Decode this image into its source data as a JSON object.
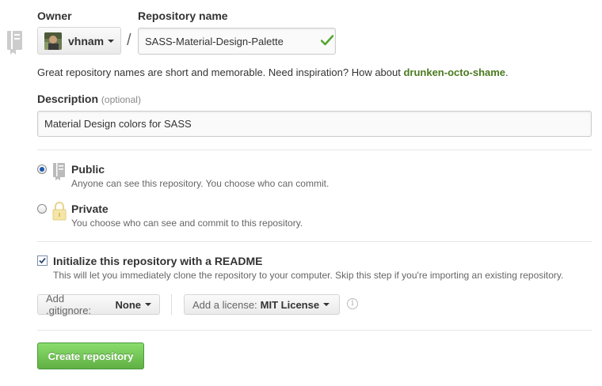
{
  "owner": {
    "label": "Owner",
    "selected": "vhnam"
  },
  "repo_name": {
    "label": "Repository name",
    "value": "SASS-Material-Design-Palette",
    "separator": "/"
  },
  "hint": {
    "text": "Great repository names are short and memorable. Need inspiration? How about ",
    "suggestion": "drunken-octo-shame",
    "end": "."
  },
  "description": {
    "label": "Description",
    "optional": "(optional)",
    "value": "Material Design colors for SASS"
  },
  "visibility": {
    "selected": "public",
    "public": {
      "title": "Public",
      "desc": "Anyone can see this repository. You choose who can commit."
    },
    "private": {
      "title": "Private",
      "desc": "You choose who can see and commit to this repository."
    }
  },
  "readme": {
    "checked": true,
    "title": "Initialize this repository with a README",
    "desc": "This will let you immediately clone the repository to your computer. Skip this step if you're importing an existing repository."
  },
  "gitignore": {
    "prefix": "Add .gitignore:",
    "value": "None"
  },
  "license": {
    "prefix": "Add a license:",
    "value": "MIT License"
  },
  "submit": {
    "label": "Create repository"
  },
  "colors": {
    "accent_green": "#60b044",
    "suggestion_green": "#4a7a1e",
    "check_green": "#55a532"
  }
}
